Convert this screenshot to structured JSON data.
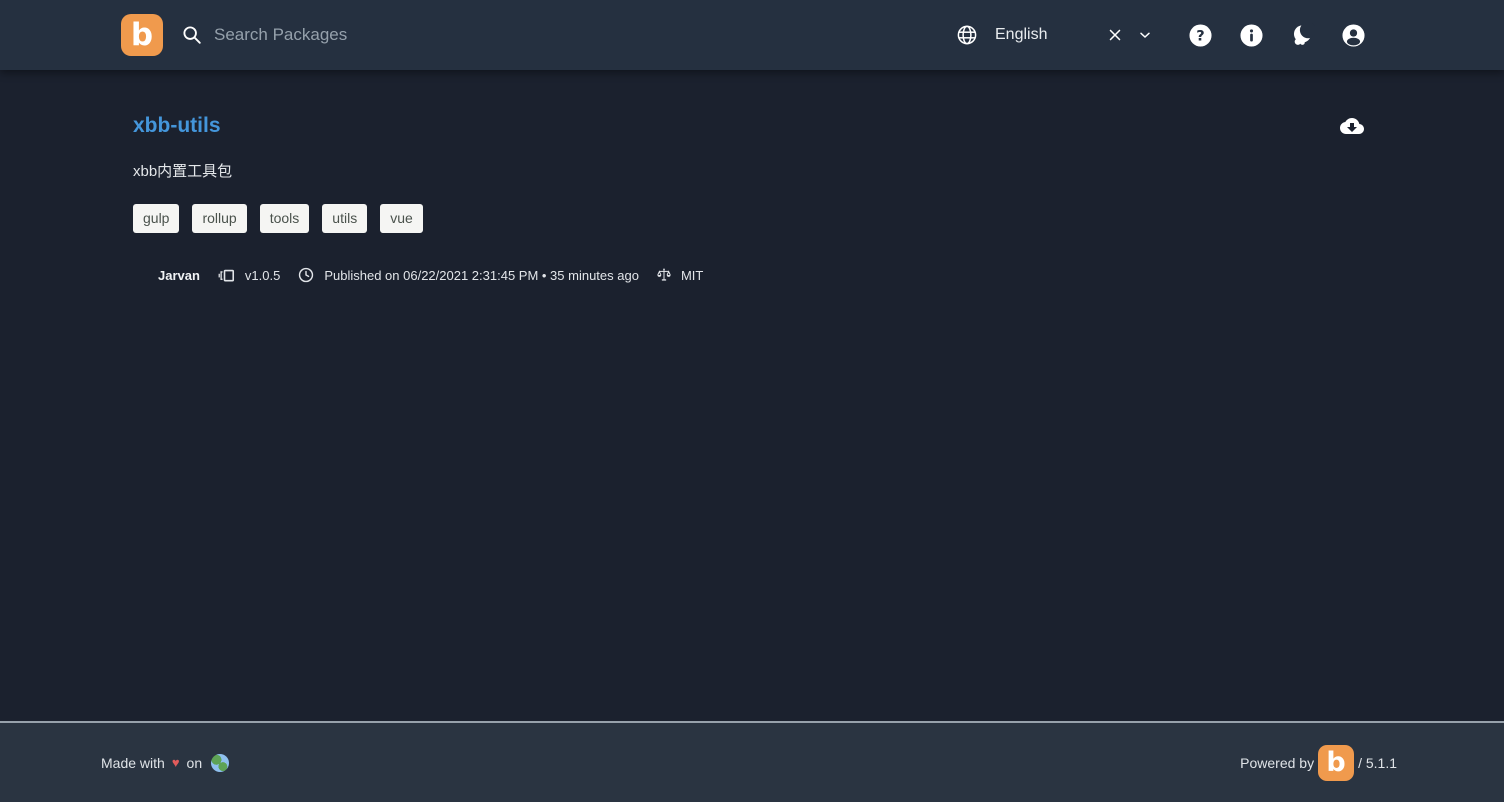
{
  "colors": {
    "header_bg": "#253040",
    "body_bg": "#1b212e",
    "footer_bg": "#2a3441",
    "brand_orange": "#f09a4d",
    "package_title_blue": "#4496db",
    "heart_red": "#e25b5b",
    "keyword_chip_bg": "#f5f5f3"
  },
  "header": {
    "logo_letter": "b",
    "search_placeholder": "Search Packages",
    "language_value": "English",
    "icons": [
      "search-icon",
      "globe-icon",
      "clear-icon",
      "chevron-down-icon",
      "help-icon",
      "info-icon",
      "dark-mode-icon",
      "account-icon"
    ]
  },
  "package": {
    "name": "xbb-utils",
    "description": "xbb内置工具包",
    "keywords": [
      "gulp",
      "rollup",
      "tools",
      "utils",
      "vue"
    ],
    "author": "Jarvan",
    "version": "v1.0.5",
    "published": "Published on 06/22/2021 2:31:45 PM • 35 minutes ago",
    "license": "MIT",
    "icons": [
      "cloud-download-icon",
      "version-icon",
      "clock-icon",
      "license-scale-icon"
    ]
  },
  "footer": {
    "made_with": "Made with",
    "heart": "♥",
    "on_text": "on",
    "earth_icon": "earth-icon",
    "powered_by": "Powered by",
    "logo_letter": "b",
    "app_version": "/ 5.1.1"
  }
}
